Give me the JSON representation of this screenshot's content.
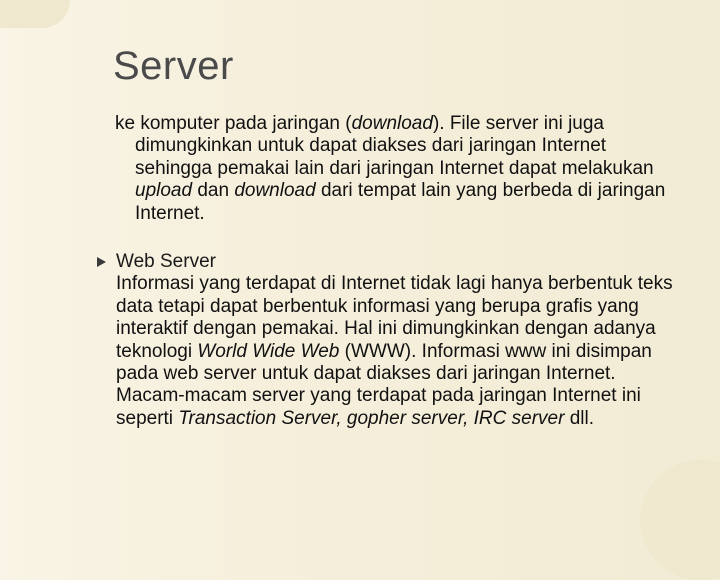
{
  "title": "Server",
  "para1_pre": "ke komputer pada jaringan (",
  "para1_dl": "download",
  "para1_mid": "). File server ini juga dimungkinkan untuk dapat diakses dari jaringan Internet sehingga pemakai lain dari jaringan Internet dapat melakukan ",
  "para1_up": "upload",
  "para1_and": " dan ",
  "para1_dl2": "download",
  "para1_post": " dari tempat lain yang berbeda di jaringan Internet.",
  "subheading": "Web Server",
  "para2_pre": "Informasi yang terdapat di Internet tidak lagi hanya berbentuk teks data tetapi dapat berbentuk informasi yang berupa grafis yang interaktif dengan pemakai. Hal ini dimungkinkan dengan adanya teknologi ",
  "para2_www": "World Wide Web",
  "para2_mid": " (WWW). Informasi www ini disimpan pada web server untuk dapat diakses dari jaringan Internet. Macam-macam server yang terdapat pada jaringan Internet ini seperti ",
  "para2_list": "Transaction Server, gopher server, IRC server",
  "para2_post": " dll."
}
